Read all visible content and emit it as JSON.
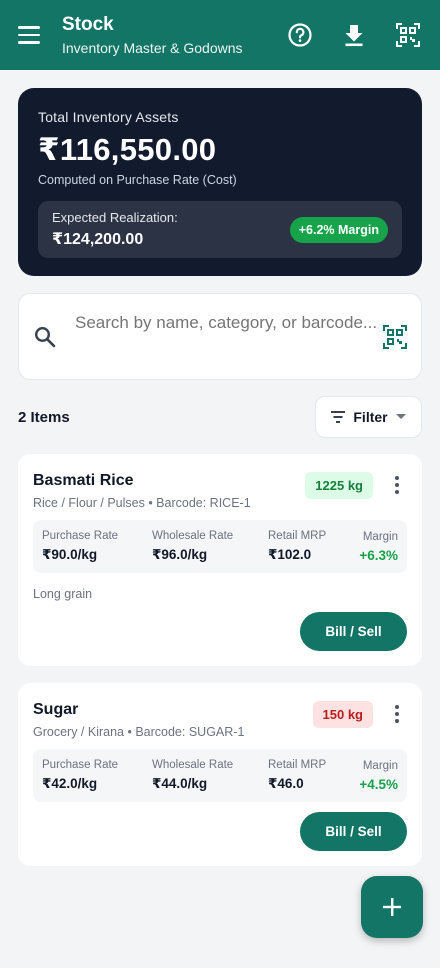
{
  "header": {
    "title": "Stock",
    "subtitle": "Inventory Master & Godowns",
    "icons": [
      "menu-icon",
      "help-icon",
      "download-icon",
      "qr-scan-icon"
    ]
  },
  "summary": {
    "label": "Total Inventory Assets",
    "amount": "₹116,550.00",
    "note": "Computed on Purchase Rate (Cost)",
    "realization_label": "Expected Realization:",
    "realization_amount": "₹124,200.00",
    "margin_badge": "+6.2% Margin"
  },
  "search": {
    "placeholder": "Search by name, category, or barcode..."
  },
  "list": {
    "count_label": "2 Items",
    "filter_label": "Filter"
  },
  "rate_labels": {
    "purchase": "Purchase Rate",
    "wholesale": "Wholesale Rate",
    "retail": "Retail MRP",
    "margin": "Margin"
  },
  "items": [
    {
      "name": "Basmati Rice",
      "meta": "Rice / Flour / Pulses • Barcode: RICE-1",
      "stock": "1225 kg",
      "purchase_rate": "₹90.0/kg",
      "wholesale_rate": "₹96.0/kg",
      "retail_mrp": "₹102.0",
      "margin": "+6.3%",
      "note": "Long grain",
      "action": "Bill / Sell"
    },
    {
      "name": "Sugar",
      "meta": "Grocery / Kirana • Barcode: SUGAR-1",
      "stock": "150 kg",
      "purchase_rate": "₹42.0/kg",
      "wholesale_rate": "₹44.0/kg",
      "retail_mrp": "₹46.0",
      "margin": "+4.5%",
      "action": "Bill / Sell"
    }
  ],
  "colors": {
    "brand": "#137566",
    "summary_bg": "#121a2d",
    "positive": "#16a34a",
    "low_stock_bg": "#fee2e2",
    "low_stock_text": "#b91c1c"
  }
}
